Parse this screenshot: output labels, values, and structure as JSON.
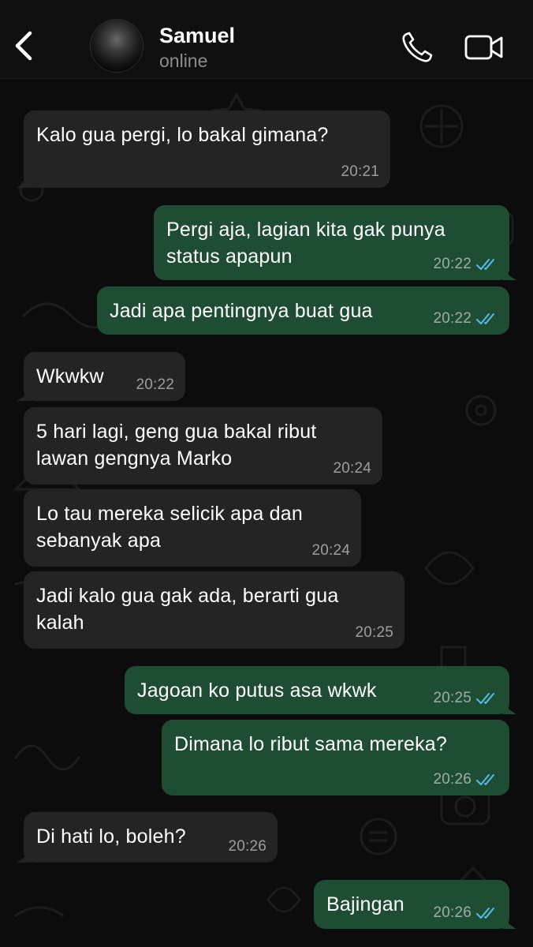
{
  "header": {
    "contact_name": "Samuel",
    "status": "online"
  },
  "messages": [
    {
      "dir": "in",
      "text": "Kalo gua pergi, lo bakal gimana?",
      "time": "20:21"
    },
    {
      "dir": "out",
      "text": "Pergi aja, lagian kita gak punya status apapun",
      "time": "20:22",
      "read": true
    },
    {
      "dir": "out",
      "text": "Jadi apa pentingnya buat gua",
      "time": "20:22",
      "read": true
    },
    {
      "dir": "in",
      "text": "Wkwkw",
      "time": "20:22"
    },
    {
      "dir": "in",
      "text": "5 hari lagi, geng gua bakal ribut lawan gengnya Marko",
      "time": "20:24"
    },
    {
      "dir": "in",
      "text": "Lo tau mereka selicik apa dan sebanyak apa",
      "time": "20:24"
    },
    {
      "dir": "in",
      "text": "Jadi kalo gua gak ada, berarti gua kalah",
      "time": "20:25"
    },
    {
      "dir": "out",
      "text": "Jagoan ko putus asa wkwk",
      "time": "20:25",
      "read": true
    },
    {
      "dir": "out",
      "text": "Dimana lo ribut sama mereka?",
      "time": "20:26",
      "read": true
    },
    {
      "dir": "in",
      "text": "Di hati lo, boleh?",
      "time": "20:26"
    },
    {
      "dir": "out",
      "text": "Bajingan",
      "time": "20:26",
      "read": true
    }
  ],
  "icons": {
    "back": "chevron-left-icon",
    "avatar": "avatar-photo",
    "call": "phone-icon",
    "video": "video-camera-icon",
    "read_receipt": "double-check-icon"
  },
  "colors": {
    "header_bg": "#101010",
    "chat_bg": "#0c0c0c",
    "incoming_bubble": "#242424",
    "outgoing_bubble": "#1f4d34",
    "read_tick": "#53bdeb",
    "status_text": "#8d8d8d"
  }
}
